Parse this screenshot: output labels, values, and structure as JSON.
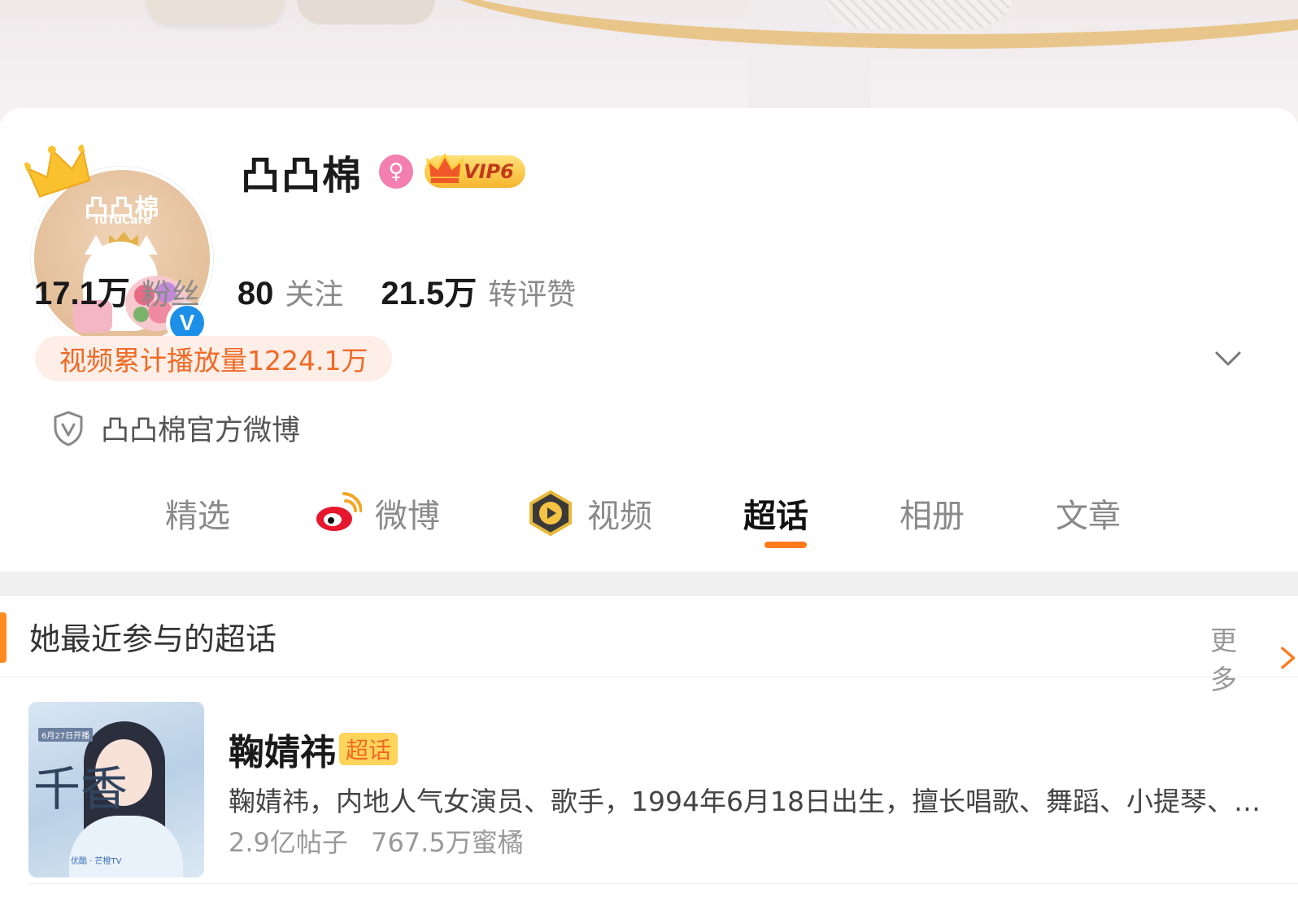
{
  "profile": {
    "name": "凸凸棉",
    "vip_label": "VIP6",
    "avatar_brand": "凸凸棉",
    "avatar_brand_en": "TuTuCare",
    "gender_symbol": "♀",
    "verified_symbol": "V"
  },
  "stats": [
    {
      "value": "17.1万",
      "label": "粉丝"
    },
    {
      "value": "80",
      "label": "关注"
    },
    {
      "value": "21.5万",
      "label": "转评赞"
    }
  ],
  "video_plays": "视频累计播放量1224.1万",
  "official_description": "凸凸棉官方微博",
  "tabs": [
    {
      "label": "精选",
      "icon": null,
      "active": false
    },
    {
      "label": "微博",
      "icon": "weibo-icon",
      "active": false
    },
    {
      "label": "视频",
      "icon": "video-play-icon",
      "active": false
    },
    {
      "label": "超话",
      "icon": null,
      "active": true
    },
    {
      "label": "相册",
      "icon": null,
      "active": false
    },
    {
      "label": "文章",
      "icon": null,
      "active": false
    }
  ],
  "supertopic_section": {
    "title": "她最近参与的超话",
    "more_label": "更多",
    "topics": [
      {
        "name": "鞠婧祎",
        "badge": "超话",
        "description": "鞠婧祎，内地人气女演员、歌手，1994年6月18日出生，擅长唱歌、舞蹈、小提琴、…",
        "posts": "2.9亿帖子",
        "fans": "767.5万蜜橘",
        "cover_calligraphy": "千香",
        "cover_date": "6月27日开播",
        "cover_tags": "优酷 · 芒橙TV"
      }
    ]
  },
  "colors": {
    "accent_orange": "#ff7a1a",
    "video_pill_bg": "#fdeee8",
    "video_pill_text": "#ef6a25",
    "verify_blue": "#1c8fe8",
    "gender_pink": "#f27fb0",
    "vip_gold": "#f6b52e"
  }
}
